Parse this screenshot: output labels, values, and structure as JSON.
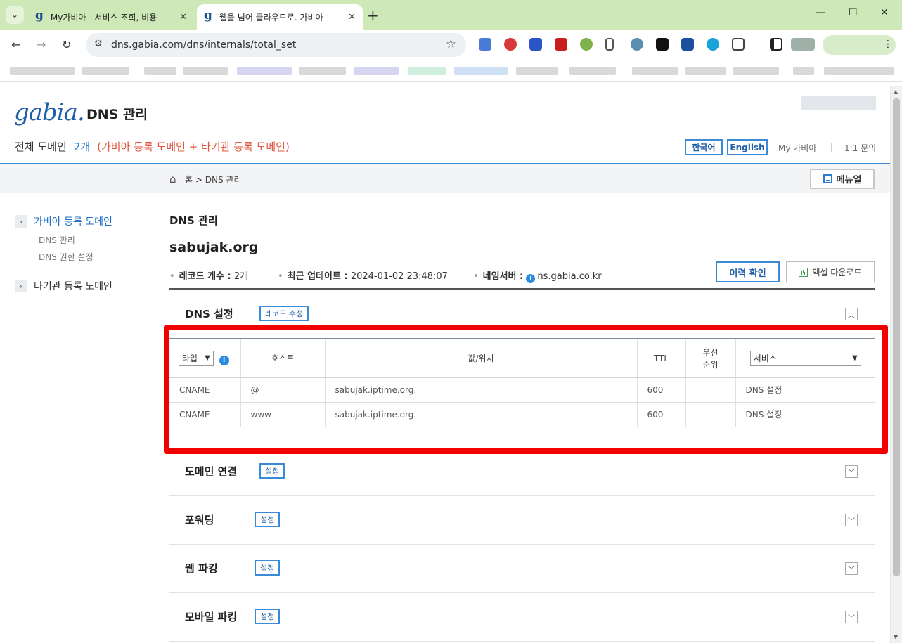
{
  "browser": {
    "tabs": [
      {
        "favicon": "g",
        "title": "My가비아 - 서비스 조회, 비용"
      },
      {
        "favicon": "g",
        "title": "웹을 넘어 클라우드로. 가비아"
      }
    ],
    "new_tab": "+",
    "address": "dns.gabia.com/dns/internals/total_set"
  },
  "header": {
    "logo": "gabia.",
    "app_title": "DNS 관리",
    "summary_label": "전체 도메인",
    "summary_count": "2개",
    "summary_note": "(가비아 등록 도메인 + 타기관 등록 도메인)",
    "lang_ko": "한국어",
    "lang_en": "English",
    "my_gabia": "My 가비아",
    "separator": "|",
    "inquiry": "1:1 문의"
  },
  "breadcrumb": {
    "home": "홈",
    "arrow": ">",
    "current": "DNS 관리",
    "manual": "메뉴얼"
  },
  "sidebar": {
    "groups": [
      {
        "label": "가비아 등록 도메인",
        "items": [
          "DNS 관리",
          "DNS 권한 설정"
        ]
      },
      {
        "label": "타기관 등록 도메인",
        "items": []
      }
    ]
  },
  "main": {
    "section_title": "DNS 관리",
    "domain": "sabujak.org",
    "record_count_label": "레코드 개수 :",
    "record_count": "2개",
    "updated_label": "최근 업데이트 :",
    "updated": "2024-01-02 23:48:07",
    "nameserver_label": "네임서버 :",
    "nameserver": "ns.gabia.co.kr",
    "history_button": "이력 확인",
    "excel_button": "엑셀 다운로드"
  },
  "dns_settings": {
    "title": "DNS 설정",
    "edit_button": "레코드 수정",
    "columns": {
      "type_filter": "타입",
      "host": "호스트",
      "value": "값/위치",
      "ttl": "TTL",
      "priority_1": "우선",
      "priority_2": "순위",
      "service_filter": "서비스"
    },
    "rows": [
      {
        "type": "CNAME",
        "host": "@",
        "value": "sabujak.iptime.org.",
        "ttl": "600",
        "priority": "",
        "service": "DNS 설정"
      },
      {
        "type": "CNAME",
        "host": "www",
        "value": "sabujak.iptime.org.",
        "ttl": "600",
        "priority": "",
        "service": "DNS 설정"
      }
    ]
  },
  "accordion": [
    {
      "title": "도메인 연결",
      "button": "설정"
    },
    {
      "title": "포워딩",
      "button": "설정"
    },
    {
      "title": "웹 파킹",
      "button": "설정"
    },
    {
      "title": "모바일 파킹",
      "button": "설정"
    }
  ],
  "colors": {
    "accent": "#3a8ad6",
    "logo": "#1f5ea8",
    "note": "#e0553f",
    "highlight": "#f10000"
  }
}
